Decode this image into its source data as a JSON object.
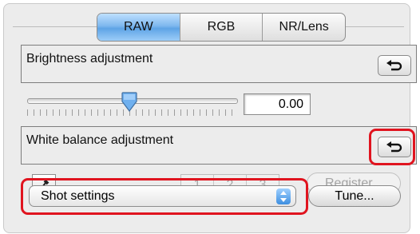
{
  "tabs": [
    {
      "label": "RAW",
      "active": true
    },
    {
      "label": "RGB",
      "active": false
    },
    {
      "label": "NR/Lens",
      "active": false
    }
  ],
  "brightness": {
    "label": "Brightness adjustment",
    "value_text": "0.00",
    "slider_fraction": 0.49,
    "reset_icon": "undo-arrow-icon"
  },
  "white_balance": {
    "label": "White balance adjustment",
    "reset_icon": "undo-arrow-icon",
    "eyedropper_icon": "eyedropper-icon",
    "slots": [
      "1",
      "2",
      "3"
    ],
    "register_label": "Register...",
    "select_value": "Shot settings",
    "tune_label": "Tune..."
  },
  "colors": {
    "highlight": "#e0141f",
    "active_tab": "#7fb8ee",
    "select_arrows": "#3d8ee0"
  }
}
